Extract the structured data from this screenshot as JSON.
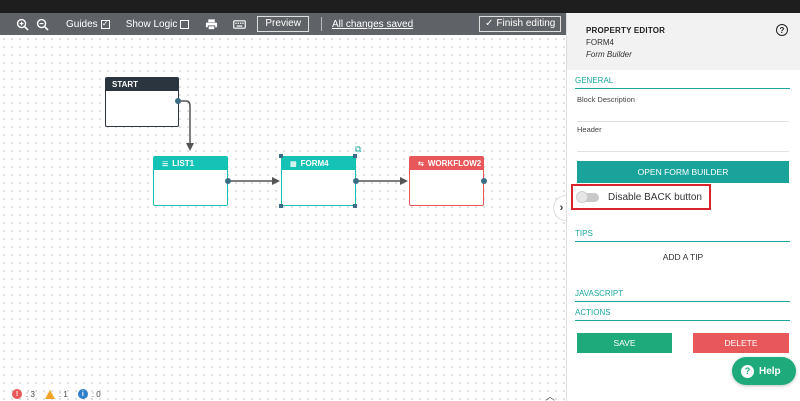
{
  "toolbar": {
    "guides_label": "Guides",
    "guides_checked": "✓",
    "show_logic_label": "Show Logic",
    "preview_label": "Preview",
    "save_status": "All changes saved",
    "finish_label": "Finish editing"
  },
  "blocks": {
    "start": "START",
    "list": "LIST1",
    "form": "FORM4",
    "workflow": "WORKFLOW2"
  },
  "status": {
    "errors": ": 3",
    "warnings": ": 1",
    "info": ": 0"
  },
  "panel": {
    "title": "PROPERTY EDITOR",
    "subtitle": "FORM4",
    "type": "Form Builder",
    "help_glyph": "?",
    "sections": {
      "general": "GENERAL",
      "tips": "TIPS",
      "javascript": "JAVASCRIPT",
      "actions": "ACTIONS"
    },
    "fields": {
      "block_description": "Block Description",
      "header": "Header"
    },
    "open_form_builder": "OPEN FORM BUILDER",
    "disable_back": "Disable BACK button",
    "add_tip": "ADD A TIP",
    "save": "SAVE",
    "delete": "DELETE"
  },
  "help_button": "Help",
  "colors": {
    "teal": "#14c3b5",
    "red": "#e8575a",
    "green": "#1faa7b",
    "dark": "#2b3540",
    "highlight": "#d9232d"
  }
}
